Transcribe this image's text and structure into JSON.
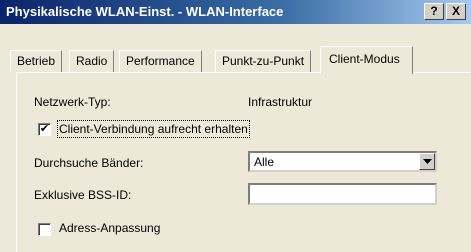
{
  "window": {
    "title": "Physikalische WLAN-Einst. - WLAN-Interface",
    "help_label": "?",
    "close_label": "X"
  },
  "tabs": [
    {
      "label": "Betrieb"
    },
    {
      "label": "Radio"
    },
    {
      "label": "Performance"
    },
    {
      "label": "Punkt-zu-Punkt"
    },
    {
      "label": "Client-Modus",
      "active": true
    }
  ],
  "form": {
    "network_type_label": "Netzwerk-Typ:",
    "network_type_value": "Infrastruktur",
    "keep_connection_label": "Client-Verbindung aufrecht erhalten",
    "keep_connection_checked": true,
    "keep_connection_mark": "✔",
    "scan_bands_label": "Durchsuche Bänder:",
    "scan_bands_value": "Alle",
    "exclusive_bssid_label": "Exklusive BSS-ID:",
    "exclusive_bssid_value": "",
    "address_adaptation_label": "Adress-Anpassung",
    "address_adaptation_checked": false
  }
}
